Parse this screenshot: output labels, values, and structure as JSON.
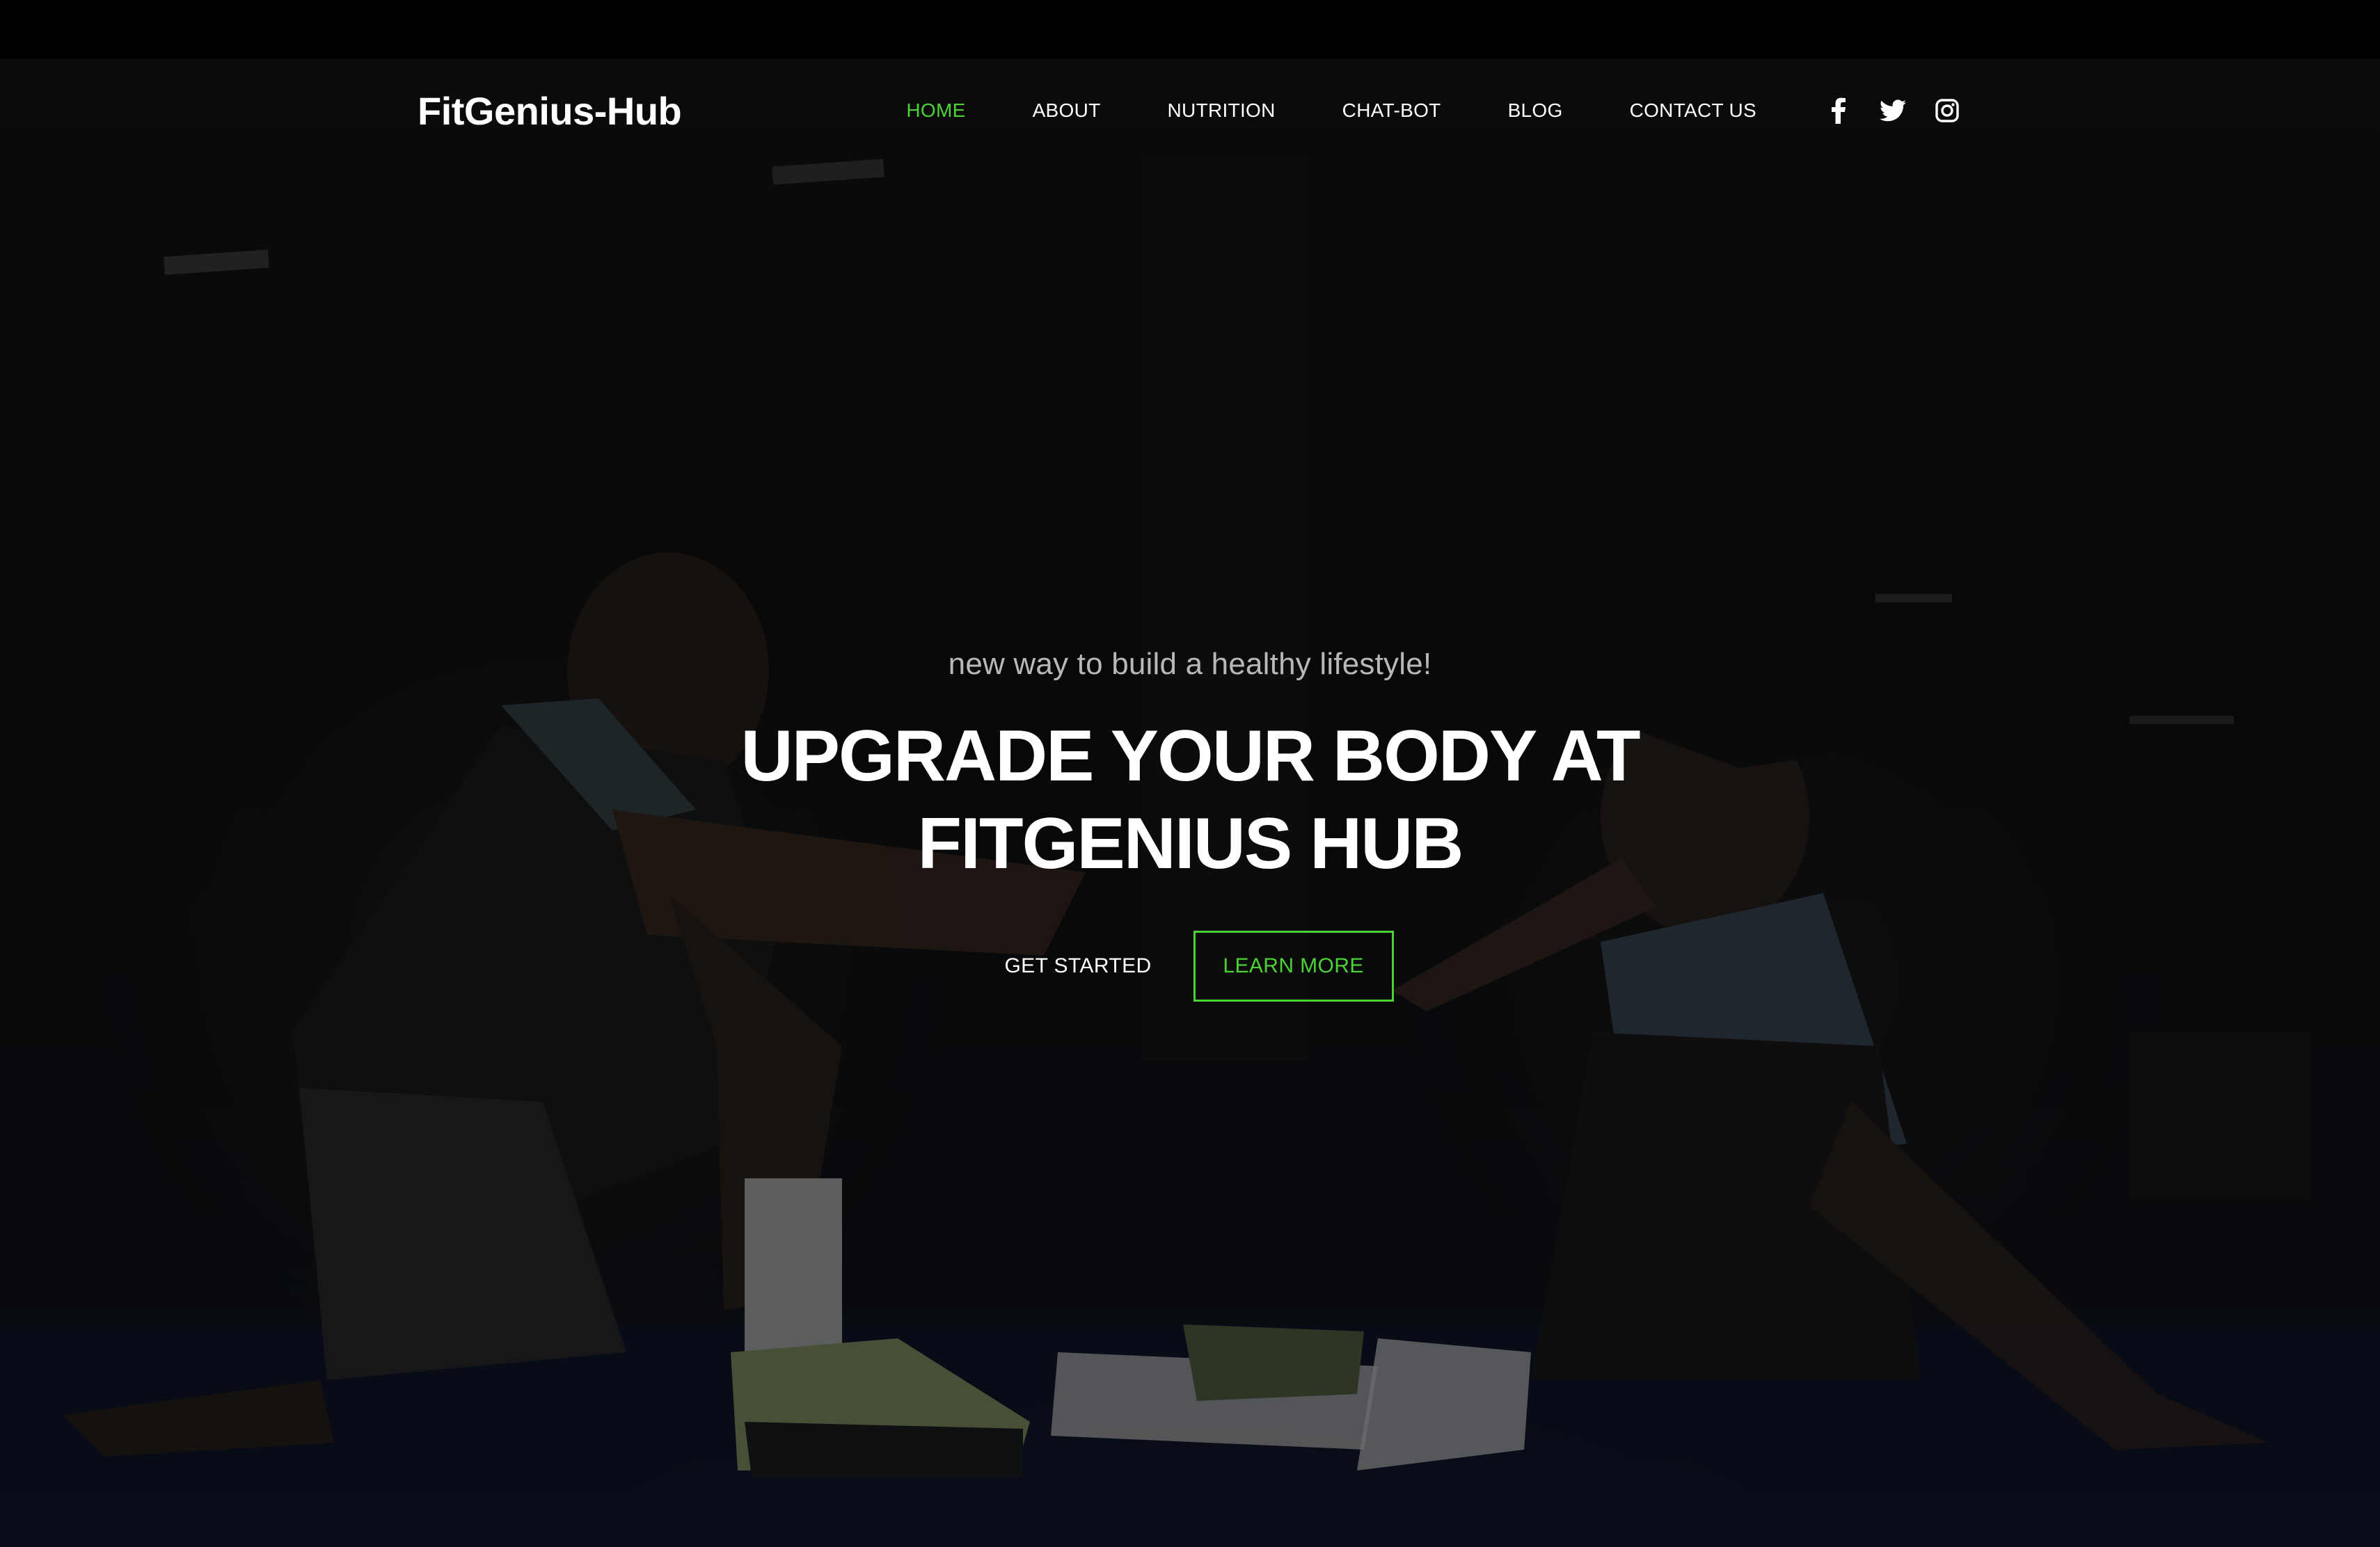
{
  "brand": {
    "name": "FitGenius-Hub"
  },
  "nav": {
    "items": [
      {
        "label": "HOME",
        "active": true
      },
      {
        "label": "ABOUT",
        "active": false
      },
      {
        "label": "NUTRITION",
        "active": false
      },
      {
        "label": "CHAT-BOT",
        "active": false
      },
      {
        "label": "BLOG",
        "active": false
      },
      {
        "label": "CONTACT US",
        "active": false
      }
    ]
  },
  "social": {
    "icons": [
      "facebook-icon",
      "twitter-icon",
      "instagram-icon"
    ]
  },
  "hero": {
    "tagline": "new way to build a healthy lifestyle!",
    "headline_line1": "UPGRADE YOUR BODY AT",
    "headline_line2": "FITGENIUS HUB",
    "primary_cta": "GET STARTED",
    "secondary_cta": "LEARN MORE"
  },
  "colors": {
    "accent": "#4cd137",
    "text": "#ffffff",
    "background": "#111111"
  }
}
